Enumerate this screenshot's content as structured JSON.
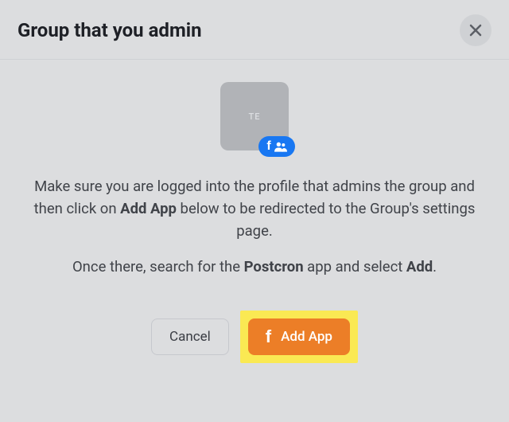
{
  "header": {
    "title": "Group that you admin"
  },
  "tile": {
    "label": "TE",
    "badge_f": "f"
  },
  "instructions": {
    "line1_pre": "Make sure you are logged into the profile that admins the group and then click on ",
    "line1_bold": "Add App",
    "line1_post": " below to be redirected to the Group's settings page.",
    "line2_pre": "Once there, search for the ",
    "line2_bold1": "Postcron",
    "line2_mid": " app and select ",
    "line2_bold2": "Add",
    "line2_post": "."
  },
  "buttons": {
    "cancel": "Cancel",
    "add_app": "Add App",
    "fb_glyph": "f"
  }
}
